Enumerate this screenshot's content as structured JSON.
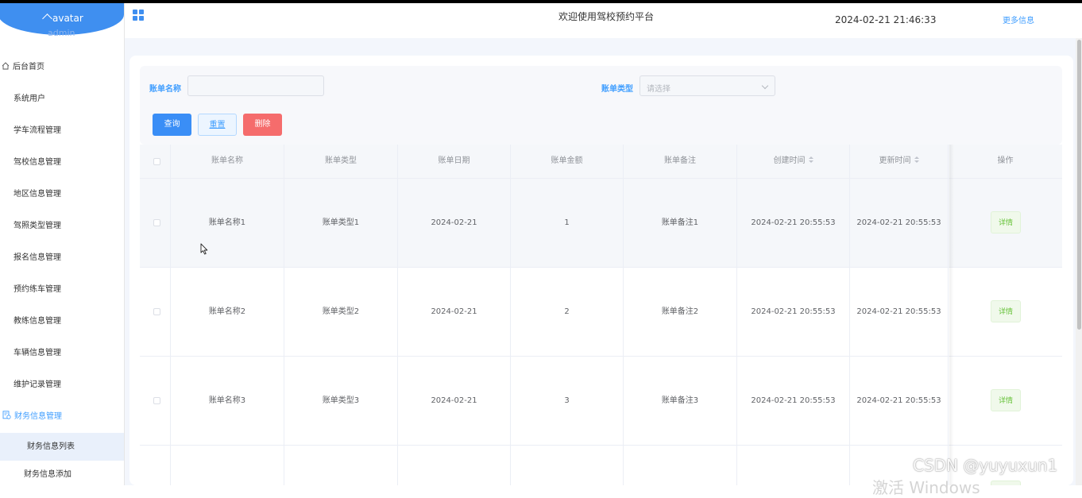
{
  "sidebar": {
    "avatar_alt": "avatar",
    "username": "admin",
    "menu": [
      "后台首页",
      "系统用户",
      "学车流程管理",
      "驾校信息管理",
      "地区信息管理",
      "驾照类型管理",
      "报名信息管理",
      "预约练车管理",
      "教练信息管理",
      "车辆信息管理",
      "维护记录管理",
      "财务信息管理"
    ],
    "submenu": [
      "财务信息列表",
      "财务信息添加"
    ]
  },
  "header": {
    "title": "欢迎使用驾校预约平台",
    "time": "2024-02-21 21:46:33",
    "more": "更多信息"
  },
  "search": {
    "name_label": "账单名称",
    "name_value": "",
    "type_label": "账单类型",
    "type_placeholder": "请选择",
    "query_label": "查询",
    "reset_label": "重置",
    "delete_label": "删除"
  },
  "table": {
    "columns": [
      "账单名称",
      "账单类型",
      "账单日期",
      "账单金额",
      "账单备注",
      "创建时间",
      "更新时间",
      "操作"
    ],
    "rows": [
      {
        "name": "账单名称1",
        "type": "账单类型1",
        "date": "2024-02-21",
        "amount": "1",
        "remark": "账单备注1",
        "created": "2024-02-21 20:55:53",
        "updated": "2024-02-21 20:55:53",
        "action": "详情"
      },
      {
        "name": "账单名称2",
        "type": "账单类型2",
        "date": "2024-02-21",
        "amount": "2",
        "remark": "账单备注2",
        "created": "2024-02-21 20:55:53",
        "updated": "2024-02-21 20:55:53",
        "action": "详情"
      },
      {
        "name": "账单名称3",
        "type": "账单类型3",
        "date": "2024-02-21",
        "amount": "3",
        "remark": "账单备注3",
        "created": "2024-02-21 20:55:53",
        "updated": "2024-02-21 20:55:53",
        "action": "详情"
      }
    ]
  },
  "watermark": {
    "csdn": "CSDN @yuyuxun1",
    "windows": "激活 Windows"
  },
  "colors": {
    "accent": "#409eff",
    "danger": "#f56c6c",
    "success": "#67c23a"
  },
  "icons": [
    "home-icon",
    "finance-icon",
    "grid-menu-icon",
    "chevron-down-icon",
    "sort-caret-icon",
    "broken-image-icon",
    "mouse-cursor-icon"
  ]
}
